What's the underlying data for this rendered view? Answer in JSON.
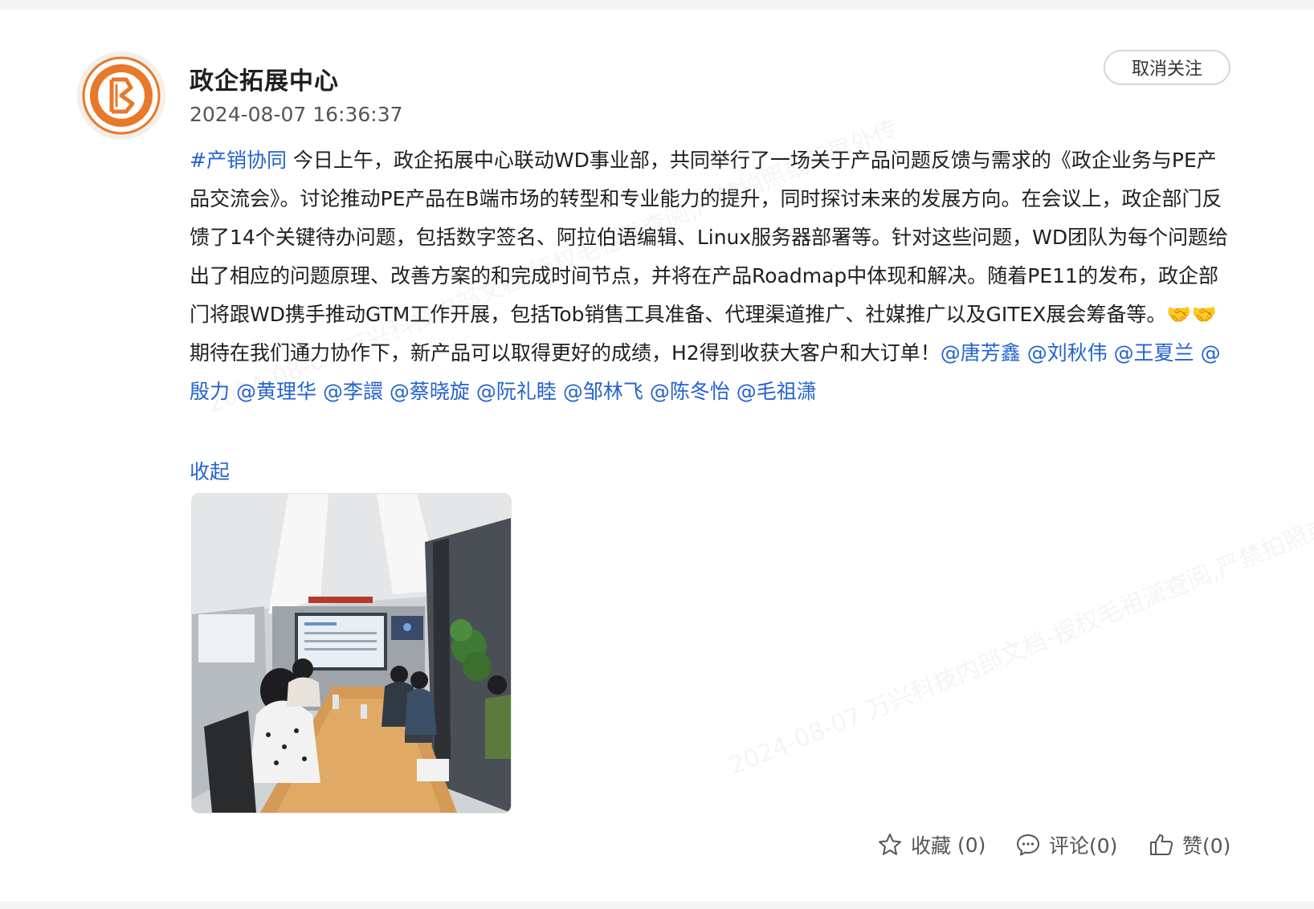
{
  "post": {
    "author": "政企拓展中心",
    "timestamp": "2024-08-07 16:36:37",
    "follow_button": "取消关注",
    "hashtag": "#产销协同",
    "body_text": " 今日上午，政企拓展中心联动WD事业部，共同举行了一场关于产品问题反馈与需求的《政企业务与PE产品交流会》。讨论推动PE产品在B端市场的转型和专业能力的提升，同时探讨未来的发展方向。在会议上，政企部门反馈了14个关键待办问题，包括数字签名、阿拉伯语编辑、Linux服务器部署等。针对这些问题，WD团队为每个问题给出了相应的问题原理、改善方案的和完成时间节点，并将在产品Roadmap中体现和解决。随着PE11的发布，政企部门将跟WD携手推动GTM工作开展，包括Tob销售工具准备、代理渠道推广、社媒推广以及GITEX展会筹备等。🤝🤝期待在我们通力协作下，新产品可以取得更好的成绩，H2得到收获大客户和大订单！",
    "mentions": [
      "@唐芳鑫",
      "@刘秋伟",
      "@王夏兰",
      "@殷力",
      "@黄理华",
      "@李譞",
      "@蔡晓旋",
      "@阮礼睦",
      "@邹林飞",
      "@陈冬怡",
      "@毛祖潇"
    ],
    "collapse_link": "收起",
    "avatar_icon": "organization-logo-icon",
    "photo_icon": "meeting-room-photo"
  },
  "actions": {
    "favorite_label": "收藏",
    "favorite_count": "(0)",
    "comment_label": "评论(0)",
    "like_label": "赞(0)"
  },
  "watermark": {
    "text": "2024-08-07 万兴科技内部文档-授权毛祖潇查阅,严禁拍照或截屏外传"
  },
  "colors": {
    "link": "#2463cf",
    "logo_orange": "#e8792a",
    "background": "#ffffff"
  }
}
